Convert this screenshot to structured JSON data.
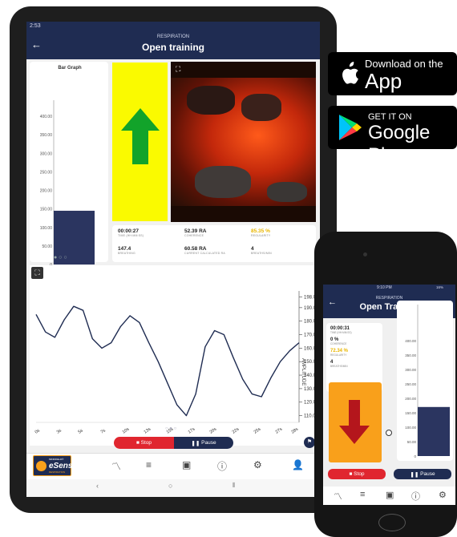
{
  "tablet": {
    "status_time": "2:53",
    "header": {
      "subtitle": "RESPIRATION",
      "title": "Open training"
    },
    "bar_graph": {
      "title": "Bar Graph",
      "yticks": [
        "400.00",
        "350.00",
        "300.00",
        "250.00",
        "200.00",
        "150.00",
        "100.00",
        "50.00",
        "0"
      ],
      "value": 145,
      "ymax": 430
    },
    "stats": [
      {
        "value": "00:00:27",
        "label": "TIME (HH:MM:SS)"
      },
      {
        "value": "52.39 RA",
        "label": "COHERENCE"
      },
      {
        "value": "85.35 %",
        "label": "REGULARITY"
      },
      {
        "value": "147.4",
        "label": "BREATHING"
      },
      {
        "value": "60.58 RA",
        "label": "CURRENT CALCULATED RA"
      },
      {
        "value": "4",
        "label": "BREATHS/MIN"
      }
    ],
    "chart_data": {
      "type": "line",
      "ylabel": "AMPLITUDE",
      "yticks": [
        "198.0",
        "190.0",
        "180.0",
        "170.0",
        "160.0",
        "150.0",
        "140.0",
        "130.0",
        "120.0",
        "110.0"
      ],
      "xticks": [
        "0s",
        "3s",
        "5s",
        "7s",
        "10s",
        "13s",
        "15s",
        "17s",
        "20s",
        "22s",
        "25s",
        "27s",
        "28s"
      ],
      "x": [
        0,
        1,
        2,
        3,
        4,
        5,
        6,
        7,
        8,
        9,
        10,
        11,
        12,
        13,
        14,
        15,
        16,
        17,
        18,
        19,
        20,
        21,
        22,
        23,
        24,
        25,
        26,
        27,
        28
      ],
      "y": [
        185,
        172,
        168,
        181,
        191,
        188,
        167,
        160,
        164,
        176,
        184,
        179,
        164,
        150,
        134,
        118,
        110,
        126,
        161,
        173,
        170,
        153,
        137,
        126,
        124,
        138,
        150,
        158,
        164
      ],
      "ylim": [
        105,
        200
      ]
    },
    "buttons": {
      "stop": "Stop",
      "pause": "Pause"
    },
    "logo": {
      "brand": "eSense",
      "top": "MINDFIELD®",
      "sub": "RESPIRATION"
    }
  },
  "phone": {
    "status_time": "9:10 PM",
    "battery": "16%",
    "header": {
      "subtitle": "RESPIRATION",
      "title": "Open Training"
    },
    "stats": [
      {
        "value": "00:00:31",
        "label": "TIME (HH:MM:SS)",
        "color": "#222222"
      },
      {
        "value": "0 %",
        "label": "COHERENCE",
        "color": "#222222"
      },
      {
        "value": "72.34 %",
        "label": "REGULARITY",
        "color": "#e9b600"
      },
      {
        "value": "4",
        "label": "BREATHS/MIN",
        "color": "#222222"
      }
    ],
    "yticks": [
      "400.00",
      "350.00",
      "300.00",
      "250.00",
      "200.00",
      "150.00",
      "100.00",
      "50.00",
      "0"
    ],
    "bar_value": 170,
    "buttons": {
      "stop": "Stop",
      "pause": "Pause"
    }
  },
  "stores": {
    "apple": {
      "line1": "Download on the",
      "line2": "App Store"
    },
    "google": {
      "line1": "GET IT ON",
      "line2": "Google Play"
    }
  },
  "colors": {
    "navy": "#1f2c52",
    "bar": "#2b3560",
    "red": "#e0262f",
    "yellow": "#fafa00",
    "orange": "#f9a01b",
    "green": "#12a32a",
    "darkred": "#b4161c"
  }
}
